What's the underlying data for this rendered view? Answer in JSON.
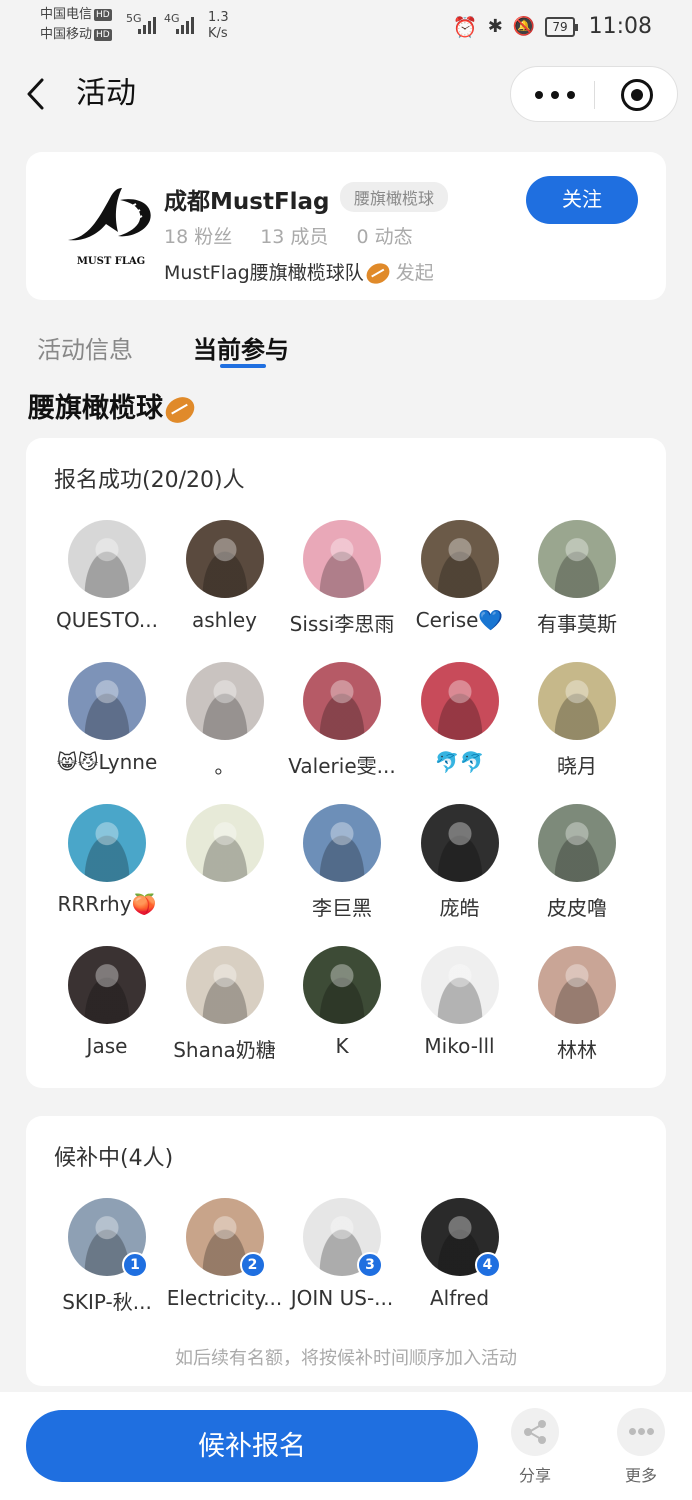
{
  "status_bar": {
    "carrier1": "中国电信",
    "carrier2": "中国移动",
    "hd": "HD",
    "net1": "5G",
    "net2": "4G",
    "speed_value": "1.3",
    "speed_unit": "K/s",
    "battery": "79",
    "time": "11:08"
  },
  "nav": {
    "back_icon": "chevron-left",
    "title": "活动"
  },
  "club": {
    "logo_text": "MUST FLAG",
    "name": "成都MustFlag",
    "tag": "腰旗橄榄球",
    "fans": "18 粉丝",
    "members": "13 成员",
    "posts": "0 动态",
    "desc": "MustFlag腰旗橄榄球队",
    "desc_suffix": "发起",
    "follow_label": "关注"
  },
  "tabs": {
    "info": "活动信息",
    "current": "当前参与"
  },
  "activity": {
    "title": "腰旗橄榄球"
  },
  "signup": {
    "title": "报名成功(20/20)人",
    "people": [
      {
        "name": "QUESTO...",
        "color": "#d7d7d7"
      },
      {
        "name": "ashley",
        "color": "#5a4a3e"
      },
      {
        "name": "Sissi李思雨",
        "color": "#e9a8b8"
      },
      {
        "name": "Cerise💙",
        "color": "#6b5a48"
      },
      {
        "name": "有事莫斯",
        "color": "#9aa68f"
      },
      {
        "name": "😸😼Lynne",
        "color": "#7d93b8"
      },
      {
        "name": "。",
        "color": "#c9c3c0"
      },
      {
        "name": "Valerie雯...",
        "color": "#b65a66"
      },
      {
        "name": "🐬🐬",
        "color": "#c84b5a"
      },
      {
        "name": "晓月",
        "color": "#c6b88a"
      },
      {
        "name": "RRRrhy🍑",
        "color": "#4aa6c9"
      },
      {
        "name": "",
        "color": "#e7ead8"
      },
      {
        "name": "李巨黑",
        "color": "#6d8fb8"
      },
      {
        "name": "庞皓",
        "color": "#2f2f2f"
      },
      {
        "name": "皮皮噜",
        "color": "#7d8a7a"
      },
      {
        "name": "Jase",
        "color": "#3a3232"
      },
      {
        "name": "Shana奶糖",
        "color": "#d8cfc2"
      },
      {
        "name": "K",
        "color": "#3d4b36"
      },
      {
        "name": "Miko-lll",
        "color": "#efefef"
      },
      {
        "name": "林林",
        "color": "#c9a596"
      }
    ]
  },
  "waitlist": {
    "title": "候补中(4人)",
    "people": [
      {
        "name": "SKIP-秋...",
        "rank": "1",
        "color": "#8ea0b4"
      },
      {
        "name": "Electricity...",
        "rank": "2",
        "color": "#c8a48a"
      },
      {
        "name": "JOIN US-...",
        "rank": "3",
        "color": "#e6e6e6"
      },
      {
        "name": "Alfred",
        "rank": "4",
        "color": "#2a2a2a"
      }
    ],
    "note": "如后续有名额，将按候补时间顺序加入活动"
  },
  "bottom": {
    "join_label": "候补报名",
    "share_label": "分享",
    "more_label": "更多"
  },
  "colors": {
    "accent": "#1f6fe0",
    "background": "#f3f3f3",
    "card": "#ffffff"
  }
}
